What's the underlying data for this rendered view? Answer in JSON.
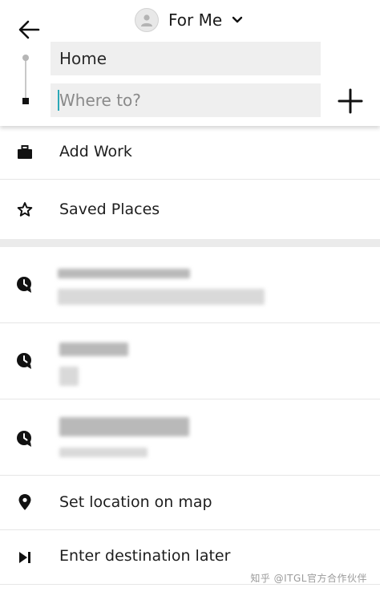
{
  "header": {
    "rider_label": "For Me",
    "pickup_value": "Home",
    "destination_placeholder": "Where to?"
  },
  "shortcuts": [
    {
      "label": "Add Work",
      "icon": "briefcase-icon"
    },
    {
      "label": "Saved Places",
      "icon": "star-icon"
    }
  ],
  "recent_places_count_shown": 3,
  "actions": [
    {
      "label": "Set location on map",
      "icon": "map-pin-icon"
    },
    {
      "label": "Enter destination later",
      "icon": "skip-forward-icon"
    }
  ],
  "watermark": "知乎 @ITGL官方合作伙伴",
  "colors": {
    "cursor_accent": "#2aa8b8",
    "field_background": "#efefef",
    "section_separator": "#ebebeb"
  }
}
